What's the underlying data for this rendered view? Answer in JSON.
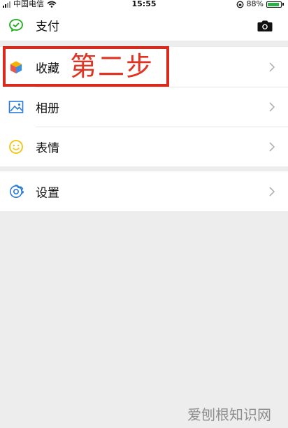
{
  "status_bar": {
    "carrier": "中国电信",
    "time": "15:55",
    "battery": "88%",
    "battery_level": 0.88
  },
  "menu_top": [
    {
      "id": "pay",
      "label": "支付",
      "icon": "wechat-pay-icon"
    }
  ],
  "menu_main": [
    {
      "id": "favorites",
      "label": "收藏",
      "icon": "cube-icon"
    },
    {
      "id": "album",
      "label": "相册",
      "icon": "image-icon"
    },
    {
      "id": "stickers",
      "label": "表情",
      "icon": "smiley-icon"
    }
  ],
  "menu_settings": [
    {
      "id": "settings",
      "label": "设置",
      "icon": "gear-icon"
    }
  ],
  "annotation": {
    "text": "第二步",
    "color": "#d92a1e"
  },
  "watermark": "爱刨根知识网",
  "colors": {
    "pay_green": "#1aad19",
    "settings_blue": "#2a7ad8",
    "stickers_yellow": "#f4c20d"
  }
}
